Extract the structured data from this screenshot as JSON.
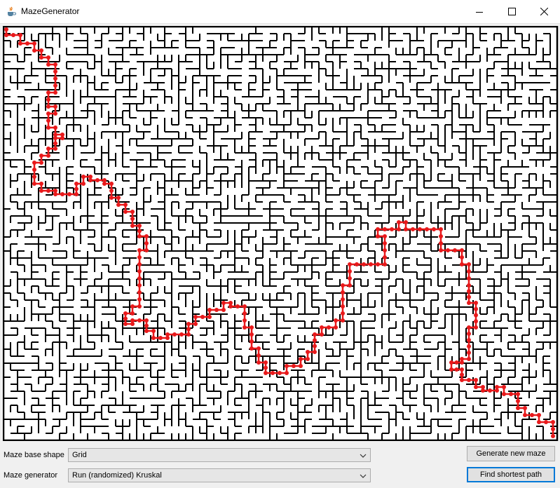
{
  "window": {
    "title": "MazeGenerator"
  },
  "controls": {
    "base_shape_label": "Maze base shape",
    "base_shape_value": "Grid",
    "generator_label": "Maze generator",
    "generator_value": "Run (randomized) Kruskal",
    "generate_button": "Generate new maze",
    "find_path_button": "Find shortest path"
  },
  "colors": {
    "wall": "#000000",
    "path": "#e8191b",
    "background": "#ffffff"
  },
  "icons": [
    "java-cup-icon",
    "minimize-icon",
    "maximize-icon",
    "close-icon",
    "chevron-down-icon"
  ]
}
